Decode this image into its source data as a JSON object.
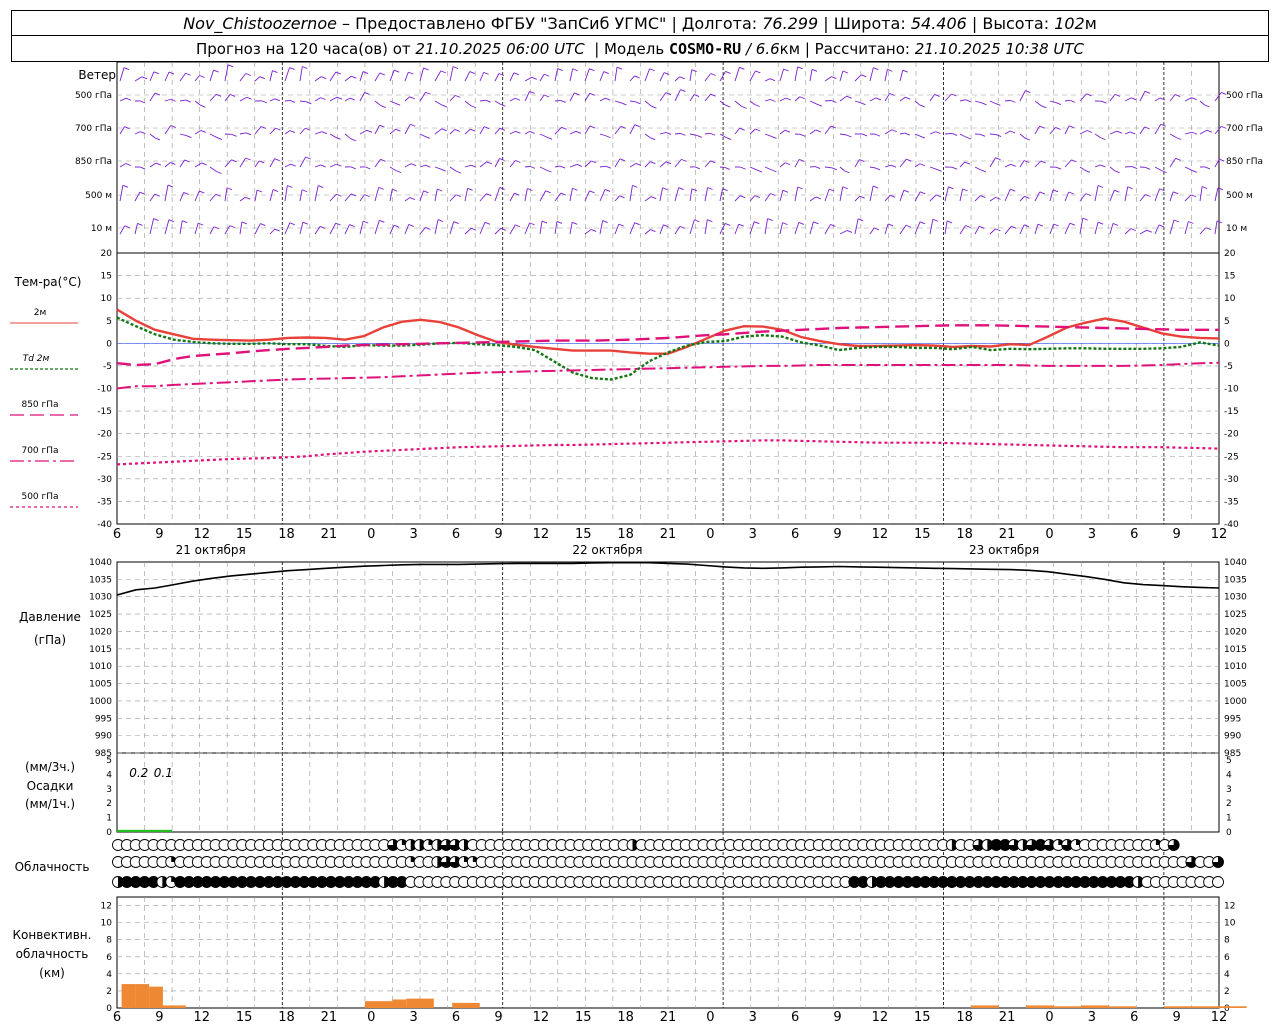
{
  "header": {
    "station": "Nov_Chistoozernoe",
    "provided": " – Предоставлено ФГБУ \"ЗапСиб УГМС\" | Долгота: ",
    "lon": "76.299",
    "lat_label": " | Широта: ",
    "lat": "54.406",
    "alt_label": " | Высота: ",
    "alt": "102",
    "alt_unit": "м",
    "forecast_prefix": "Прогноз на 120 часа(ов) от ",
    "init_time": "21.10.2025 06:00 UTC",
    "model_label": "  | Модель ",
    "model": "COSMO-RU",
    "res": " / 6.6",
    "res_unit": "км",
    "calc_label": " | Рассчитано: ",
    "calc_time": "21.10.2025 10:38 UTC"
  },
  "panels": {
    "wind": {
      "title": "Ветер",
      "levels": [
        "500 гПа",
        "700 гПа",
        "850 гПа",
        "500 м",
        "10 м"
      ]
    },
    "temp": {
      "title": "Тем-ра(°C)",
      "legend": [
        "2м",
        "Td 2м",
        "850 гПа",
        "700 гПа",
        "500 гПа"
      ]
    },
    "pressure": {
      "title1": "Давление",
      "title2": "(гПа)"
    },
    "precip": {
      "title1": "(мм/3ч.)",
      "title2": "Осадки",
      "title3": "(мм/1ч.)",
      "amounts": [
        "0.2",
        "0.1"
      ]
    },
    "cloud": {
      "title": "Облачность"
    },
    "conv": {
      "title1": "Конвективн.",
      "title2": "облачность",
      "title3": "(км)"
    }
  },
  "colors": {
    "wind": "#7b1fd1",
    "t2m": "#e8413a",
    "td2m": "#117711",
    "t850": "#e0117a",
    "t700": "#e0117a",
    "t500": "#e0117a",
    "pressure": "#000000",
    "precip": "#22bb22",
    "conv": "#ee8833",
    "grid": "#999999"
  },
  "x_axis": {
    "tick_labels": [
      "6",
      "9",
      "12",
      "15",
      "18",
      "21",
      "0",
      "3",
      "6",
      "9",
      "12",
      "15",
      "18",
      "21",
      "0",
      "3",
      "6",
      "9",
      "12",
      "15",
      "18",
      "21",
      "0",
      "3",
      "6",
      "9",
      "12"
    ],
    "day_labels": [
      "21 октября",
      "22 октября",
      "23 октября"
    ]
  },
  "chart_data": [
    {
      "type": "line",
      "title": "Тем-ра(°C)",
      "x_hours": [
        0,
        3,
        6,
        9,
        12,
        15,
        18,
        21,
        24,
        27,
        30,
        33,
        36,
        39,
        42,
        45,
        48,
        51,
        54,
        57,
        60,
        63,
        66,
        69,
        72,
        75,
        78,
        81,
        84,
        87,
        90,
        93,
        96,
        99,
        102,
        105,
        108,
        111,
        114,
        117,
        120,
        123,
        126,
        129,
        132,
        135,
        138,
        141,
        144,
        147,
        150,
        153,
        156,
        159,
        162,
        165,
        168,
        171,
        174
      ],
      "ylim": [
        -40,
        20
      ],
      "yticks": [
        20,
        15,
        10,
        5,
        0,
        -5,
        -10,
        -15,
        -20,
        -25,
        -30,
        -35,
        -40
      ],
      "series": [
        {
          "name": "2м",
          "values": [
            7.5,
            5,
            3,
            2,
            1,
            0.8,
            0.7,
            0.6,
            0.8,
            1.2,
            1.3,
            1.2,
            0.8,
            1.6,
            3.5,
            4.8,
            5.2,
            4.7,
            3.5,
            1.8,
            0.3,
            -0.3,
            -0.8,
            -1.2,
            -1.6,
            -1.6,
            -1.6,
            -2,
            -2.3,
            -2.3,
            -0.8,
            1,
            2.8,
            3.8,
            3.7,
            3,
            1.4,
            0.5,
            -0.2,
            -0.6,
            -0.6,
            -0.5,
            -0.4,
            -0.5,
            -0.8,
            -0.6,
            -0.7,
            -0.2,
            -0.4,
            1.5,
            3.5,
            4.6,
            5.5,
            4.8,
            3.5,
            2.2,
            1.5,
            1.2,
            1.1
          ]
        },
        {
          "name": "Td 2м",
          "values": [
            5.7,
            3.8,
            2,
            0.8,
            0.3,
            0,
            -0.1,
            -0.1,
            0,
            -0.2,
            -0.2,
            -0.6,
            -0.8,
            -0.4,
            -0.5,
            -0.5,
            -0.3,
            0,
            0.1,
            -0.2,
            -0.4,
            -0.8,
            -1.5,
            -4,
            -6.5,
            -7.7,
            -8,
            -7,
            -4,
            -2,
            -0.5,
            0.3,
            0.5,
            1.5,
            1.8,
            1.5,
            0.2,
            -0.5,
            -1.5,
            -1,
            -0.8,
            -0.8,
            -1,
            -1,
            -1.3,
            -0.8,
            -1.5,
            -1.2,
            -1.3,
            -1.2,
            -1.1,
            -1.1,
            -1.2,
            -1.2,
            -1.2,
            -1.1,
            -0.8,
            0.2,
            -0.5
          ]
        },
        {
          "name": "850 гПа",
          "values": [
            -4.4,
            -4.8,
            -4.6,
            -3.5,
            -2.8,
            -2.5,
            -2.2,
            -1.8,
            -1.5,
            -1.2,
            -1,
            -0.8,
            -0.5,
            -0.4,
            -0.3,
            -0.2,
            -0.1,
            0,
            0.1,
            0.2,
            0.3,
            0.4,
            0.5,
            0.6,
            0.6,
            0.6,
            0.7,
            0.8,
            1,
            1.2,
            1.5,
            1.8,
            2,
            2.3,
            2.6,
            2.8,
            3,
            3.2,
            3.4,
            3.5,
            3.6,
            3.7,
            3.8,
            3.9,
            4,
            4,
            4,
            3.9,
            3.8,
            3.7,
            3.6,
            3.5,
            3.4,
            3.3,
            3.2,
            3.1,
            3,
            3,
            3
          ]
        },
        {
          "name": "700 гПа",
          "values": [
            -10,
            -9.5,
            -9.5,
            -9.2,
            -9,
            -8.8,
            -8.6,
            -8.4,
            -8.2,
            -8,
            -7.9,
            -7.8,
            -7.7,
            -7.6,
            -7.5,
            -7.3,
            -7.1,
            -6.9,
            -6.7,
            -6.5,
            -6.4,
            -6.3,
            -6.2,
            -6.1,
            -6,
            -5.9,
            -5.8,
            -5.7,
            -5.6,
            -5.5,
            -5.4,
            -5.3,
            -5.2,
            -5.1,
            -5,
            -5,
            -4.9,
            -4.8,
            -4.8,
            -4.8,
            -4.8,
            -4.8,
            -4.8,
            -4.8,
            -4.8,
            -4.8,
            -4.8,
            -4.8,
            -4.9,
            -5,
            -5,
            -5,
            -5,
            -5,
            -4.9,
            -4.8,
            -4.6,
            -4.4,
            -4.3
          ]
        },
        {
          "name": "500 гПа",
          "values": [
            -26.8,
            -26.6,
            -26.4,
            -26.2,
            -26,
            -25.8,
            -25.6,
            -25.5,
            -25.4,
            -25.2,
            -25,
            -24.6,
            -24.3,
            -24,
            -23.8,
            -23.6,
            -23.4,
            -23.2,
            -23,
            -22.9,
            -22.8,
            -22.7,
            -22.6,
            -22.5,
            -22.5,
            -22.4,
            -22.3,
            -22.2,
            -22.1,
            -22,
            -21.9,
            -21.8,
            -21.7,
            -21.6,
            -21.5,
            -21.5,
            -21.6,
            -21.7,
            -21.8,
            -21.9,
            -22,
            -22,
            -22,
            -22,
            -22.1,
            -22.2,
            -22.3,
            -22.4,
            -22.5,
            -22.6,
            -22.7,
            -22.8,
            -22.9,
            -23,
            -23,
            -23,
            -23.1,
            -23.2,
            -23.3
          ]
        }
      ]
    },
    {
      "type": "line",
      "title": "Давление",
      "ylabel": "(гПа)",
      "ylim": [
        985,
        1040
      ],
      "yticks": [
        1040,
        1035,
        1030,
        1025,
        1020,
        1015,
        1010,
        1005,
        1000,
        995,
        990,
        985
      ],
      "x_hours": [
        0,
        3,
        6,
        9,
        12,
        15,
        18,
        21,
        24,
        27,
        30,
        33,
        36,
        39,
        42,
        45,
        48,
        51,
        54,
        57,
        60,
        63,
        66,
        69,
        72,
        75,
        78,
        81,
        84,
        87,
        90,
        93,
        96,
        99,
        102,
        105,
        108,
        111,
        114,
        117,
        120,
        123,
        126,
        129,
        132,
        135,
        138,
        141,
        144,
        147,
        150,
        153,
        156,
        159,
        162,
        165,
        168,
        171,
        174
      ],
      "series": [
        {
          "name": "Давление",
          "values": [
            1030.5,
            1032,
            1032.5,
            1033.5,
            1034.5,
            1035.3,
            1036,
            1036.5,
            1037,
            1037.5,
            1037.8,
            1038.2,
            1038.5,
            1038.8,
            1039,
            1039.2,
            1039.3,
            1039.3,
            1039.3,
            1039.4,
            1039.5,
            1039.6,
            1039.6,
            1039.6,
            1039.6,
            1039.7,
            1039.8,
            1039.8,
            1039.8,
            1039.6,
            1039.4,
            1039,
            1038.6,
            1038.3,
            1038.2,
            1038.3,
            1038.5,
            1038.6,
            1038.7,
            1038.6,
            1038.5,
            1038.4,
            1038.3,
            1038.2,
            1038.1,
            1038,
            1037.9,
            1037.8,
            1037.6,
            1037.2,
            1036.5,
            1035.8,
            1035,
            1034,
            1033.5,
            1033.2,
            1032.9,
            1032.7,
            1032.5
          ]
        }
      ]
    },
    {
      "type": "bar",
      "title": "Осадки",
      "ylim": [
        0,
        5
      ],
      "yticks": [
        5,
        4,
        3,
        2,
        1,
        0
      ],
      "bars": [
        {
          "x_start": 0,
          "x_end": 3,
          "value": 0.2
        },
        {
          "x_start": 3,
          "x_end": 6,
          "value": 0.1
        }
      ]
    },
    {
      "type": "bar",
      "title": "Конвективн. облачность",
      "ylabel": "(км)",
      "ylim": [
        0,
        13
      ],
      "yticks": [
        12,
        10,
        8,
        6,
        4,
        2,
        0
      ],
      "bars": [
        {
          "x_start": 0.5,
          "x_end": 2,
          "value": 2.8
        },
        {
          "x_start": 2,
          "x_end": 3.5,
          "value": 2.8
        },
        {
          "x_start": 3.5,
          "x_end": 5,
          "value": 2.5
        },
        {
          "x_start": 5,
          "x_end": 7.5,
          "value": 0.3
        },
        {
          "x_start": 27,
          "x_end": 30,
          "value": 0.8
        },
        {
          "x_start": 30,
          "x_end": 31.5,
          "value": 1
        },
        {
          "x_start": 31.5,
          "x_end": 34.5,
          "value": 1.1
        },
        {
          "x_start": 36.5,
          "x_end": 39.5,
          "value": 0.6
        },
        {
          "x_start": 93,
          "x_end": 96,
          "value": 0.3
        },
        {
          "x_start": 99,
          "x_end": 102,
          "value": 0.3
        },
        {
          "x_start": 102,
          "x_end": 105,
          "value": 0.2
        },
        {
          "x_start": 105,
          "x_end": 108,
          "value": 0.3
        },
        {
          "x_start": 108,
          "x_end": 111,
          "value": 0.2
        },
        {
          "x_start": 114,
          "x_end": 117,
          "value": 0.2
        },
        {
          "x_start": 117,
          "x_end": 120,
          "value": 0.2
        },
        {
          "x_start": 120,
          "x_end": 123,
          "value": 0.2
        }
      ]
    },
    {
      "type": "table",
      "title": "Облачность",
      "cloud_rows": {
        "high": [
          0,
          0,
          0,
          0,
          0,
          0,
          0,
          0,
          0,
          0,
          0,
          0,
          0,
          0,
          0,
          0,
          0,
          0,
          0,
          0,
          0,
          0,
          0,
          0,
          0,
          0,
          0,
          0,
          0,
          0,
          0,
          3,
          1,
          2,
          2,
          1,
          2,
          3,
          3,
          2,
          0,
          0,
          0,
          0,
          0,
          0,
          0,
          0,
          0,
          0,
          0,
          0,
          0,
          0,
          0,
          0,
          0,
          0,
          2,
          0,
          0,
          0,
          0,
          0,
          0,
          0,
          0,
          0,
          0,
          0,
          0,
          0,
          0,
          0,
          0,
          0,
          0,
          0,
          0,
          0,
          0,
          0,
          0,
          0,
          0,
          0,
          0,
          0,
          0,
          0,
          0,
          0,
          0,
          0,
          2,
          0,
          0,
          3,
          2,
          4,
          4,
          3,
          2,
          3,
          4,
          3,
          1,
          3,
          1,
          0,
          0,
          0,
          0,
          0,
          0,
          0,
          0,
          1,
          0,
          3
        ],
        "mid": [
          0,
          0,
          0,
          0,
          0,
          0,
          1,
          0,
          0,
          0,
          0,
          0,
          0,
          0,
          0,
          0,
          0,
          0,
          0,
          0,
          0,
          0,
          0,
          0,
          0,
          0,
          0,
          0,
          0,
          0,
          0,
          0,
          0,
          1,
          0,
          0,
          2,
          3,
          3,
          1,
          1,
          0,
          0,
          0,
          0,
          0,
          0,
          0,
          0,
          0,
          0,
          0,
          0,
          0,
          0,
          0,
          0,
          0,
          0,
          0,
          0,
          0,
          0,
          0,
          0,
          0,
          0,
          0,
          0,
          0,
          0,
          0,
          0,
          0,
          0,
          0,
          0,
          0,
          0,
          0,
          0,
          0,
          0,
          0,
          0,
          0,
          0,
          0,
          0,
          0,
          0,
          0,
          0,
          0,
          0,
          0,
          0,
          0,
          0,
          0,
          0,
          0,
          0,
          0,
          0,
          0,
          0,
          0,
          0,
          0,
          0,
          0,
          0,
          0,
          0,
          0,
          0,
          0,
          0,
          0,
          0,
          3,
          0,
          0,
          3
        ],
        "low": [
          2,
          4,
          4,
          4,
          4,
          2,
          1,
          4,
          4,
          4,
          4,
          4,
          4,
          4,
          4,
          4,
          4,
          4,
          4,
          4,
          4,
          4,
          4,
          4,
          4,
          4,
          4,
          4,
          4,
          4,
          2,
          4,
          4,
          0,
          0,
          0,
          0,
          0,
          0,
          0,
          0,
          0,
          0,
          0,
          0,
          0,
          0,
          0,
          0,
          0,
          0,
          0,
          0,
          0,
          0,
          0,
          0,
          0,
          0,
          0,
          0,
          0,
          0,
          0,
          0,
          0,
          0,
          0,
          0,
          0,
          0,
          0,
          0,
          0,
          0,
          0,
          0,
          0,
          0,
          0,
          0,
          0,
          0,
          4,
          4,
          2,
          4,
          4,
          4,
          4,
          4,
          4,
          4,
          4,
          4,
          4,
          4,
          4,
          4,
          4,
          4,
          4,
          4,
          4,
          4,
          4,
          4,
          4,
          4,
          4,
          4,
          4,
          4,
          4,
          4,
          2,
          0,
          0,
          0,
          0,
          0,
          0,
          0,
          0,
          0
        ]
      }
    }
  ]
}
